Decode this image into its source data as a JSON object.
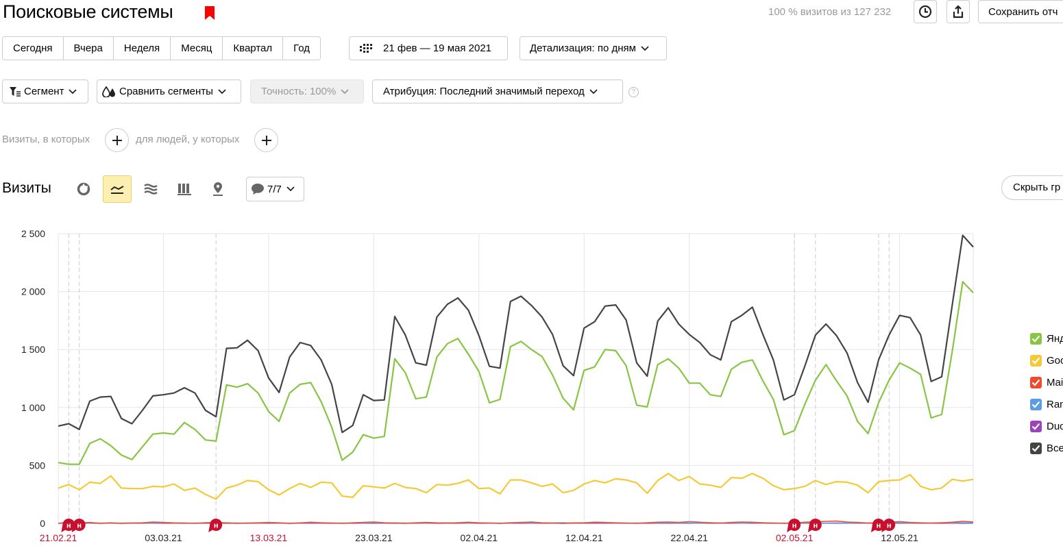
{
  "header": {
    "title": "Поисковые системы",
    "percent_text": "100 % визитов из 127 232",
    "save_label": "Сохранить отч"
  },
  "periods": [
    "Сегодня",
    "Вчера",
    "Неделя",
    "Месяц",
    "Квартал",
    "Год"
  ],
  "date_range": "21 фев — 19 мая 2021",
  "detail": "Детализация: по дням",
  "filters": {
    "segment": "Сегмент",
    "compare": "Сравнить сегменты",
    "accuracy": "Точность: 100%",
    "attribution": "Атрибуция: Последний значимый переход",
    "help": "?"
  },
  "conditions": {
    "visits": "Визиты, в которых",
    "people": "для людей, у которых"
  },
  "section": {
    "title": "Визиты",
    "notes": "7/7",
    "hide_label": "Скрыть гр"
  },
  "colors": {
    "yandex": "#87c542",
    "google": "#f5c935",
    "mail": "#f04a2e",
    "rambler": "#5a9de6",
    "duck": "#9c43bb",
    "total": "#444444",
    "holiday": "#c8102e"
  },
  "chart_data": {
    "type": "line",
    "y_ticks": [
      "2 500",
      "2 000",
      "1 500",
      "1 000",
      "500",
      "0"
    ],
    "ylim": [
      0,
      2500
    ],
    "x_ticks": [
      {
        "label": "21.02.21",
        "day": 0,
        "holiday": true
      },
      {
        "label": "03.03.21",
        "day": 10,
        "holiday": false
      },
      {
        "label": "13.03.21",
        "day": 20,
        "holiday": true
      },
      {
        "label": "23.03.21",
        "day": 30,
        "holiday": false
      },
      {
        "label": "02.04.21",
        "day": 40,
        "holiday": false
      },
      {
        "label": "12.04.21",
        "day": 50,
        "holiday": false
      },
      {
        "label": "22.04.21",
        "day": 60,
        "holiday": false
      },
      {
        "label": "02.05.21",
        "day": 70,
        "holiday": true
      },
      {
        "label": "12.05.21",
        "day": 80,
        "holiday": false
      }
    ],
    "annotations": [
      {
        "label": "н",
        "day": 1
      },
      {
        "label": "н",
        "day": 2
      },
      {
        "label": "н",
        "day": 15
      },
      {
        "label": "н",
        "day": 70
      },
      {
        "label": "н",
        "day": 72
      },
      {
        "label": "н",
        "day": 78
      },
      {
        "label": "н",
        "day": 79
      }
    ],
    "series": [
      {
        "name": "Янд",
        "key": "yandex",
        "values": [
          525,
          510,
          510,
          690,
          730,
          670,
          590,
          550,
          660,
          770,
          780,
          770,
          870,
          810,
          720,
          710,
          1195,
          1175,
          1205,
          1125,
          965,
          880,
          1125,
          1200,
          1215,
          1050,
          830,
          545,
          615,
          765,
          735,
          750,
          1420,
          1300,
          1075,
          1090,
          1435,
          1550,
          1595,
          1460,
          1310,
          1040,
          1070,
          1525,
          1570,
          1500,
          1440,
          1280,
          1080,
          980,
          1320,
          1350,
          1500,
          1490,
          1360,
          1020,
          1005,
          1370,
          1420,
          1340,
          1210,
          1210,
          1110,
          1095,
          1330,
          1390,
          1410,
          1230,
          1070,
          765,
          800,
          1030,
          1235,
          1370,
          1230,
          1100,
          880,
          775,
          1040,
          1235,
          1385,
          1340,
          1285,
          910,
          940,
          1480,
          2085,
          1990
        ]
      },
      {
        "name": "Goo",
        "key": "google",
        "values": [
          305,
          335,
          290,
          355,
          345,
          410,
          305,
          300,
          300,
          320,
          315,
          340,
          285,
          305,
          250,
          210,
          305,
          330,
          370,
          360,
          290,
          245,
          300,
          345,
          310,
          355,
          350,
          235,
          225,
          325,
          315,
          305,
          345,
          310,
          300,
          265,
          335,
          330,
          345,
          375,
          300,
          305,
          255,
          375,
          375,
          350,
          320,
          340,
          265,
          285,
          340,
          370,
          350,
          385,
          375,
          350,
          260,
          370,
          430,
          370,
          405,
          340,
          330,
          310,
          395,
          390,
          430,
          390,
          325,
          290,
          300,
          320,
          370,
          335,
          360,
          355,
          330,
          265,
          360,
          370,
          375,
          420,
          320,
          290,
          305,
          380,
          365,
          380
        ]
      },
      {
        "name": "Mai",
        "key": "mail",
        "values": [
          0,
          10,
          5,
          8,
          0,
          5,
          0,
          3,
          5,
          12,
          8,
          4,
          3,
          0,
          6,
          10,
          4,
          0,
          3,
          5,
          8,
          5,
          0,
          4,
          10,
          6,
          3,
          0,
          5,
          8,
          12,
          6,
          3,
          0,
          5,
          8,
          4,
          2,
          6,
          10,
          5,
          3,
          0,
          6,
          8,
          12,
          5,
          3,
          0,
          4,
          6,
          10,
          8,
          5,
          3,
          0,
          6,
          10,
          12,
          8,
          15,
          10,
          6,
          3,
          8,
          12,
          10,
          6,
          3,
          0,
          5,
          10,
          15,
          18,
          20,
          12,
          8,
          3,
          6,
          10,
          15,
          8,
          5,
          3,
          6,
          10,
          18,
          12
        ]
      },
      {
        "name": "Ram",
        "key": "rambler",
        "values": [
          2,
          3,
          2,
          4,
          3,
          2,
          3,
          4,
          2,
          3,
          5,
          4,
          3,
          2,
          3,
          4,
          5,
          3,
          2,
          3,
          4,
          3,
          2,
          3,
          4,
          5,
          3,
          2,
          3,
          4,
          5,
          3,
          4,
          3,
          2,
          3,
          4,
          5,
          3,
          2,
          4,
          3,
          2,
          3,
          4,
          5,
          3,
          4,
          6,
          3,
          2,
          8,
          4,
          3,
          2,
          3,
          4,
          5,
          3,
          4,
          3,
          2,
          3,
          4,
          3,
          2,
          3,
          4,
          3,
          2,
          3,
          4,
          5,
          3,
          4,
          3,
          2,
          3,
          4,
          5,
          4,
          3,
          2,
          3,
          4,
          5,
          6,
          4
        ]
      },
      {
        "name": "Duc",
        "key": "duck",
        "values": [
          1,
          2,
          1,
          2,
          1,
          2,
          1,
          2,
          1,
          2,
          1,
          2,
          1,
          2,
          1,
          2,
          1,
          2,
          1,
          2,
          1,
          2,
          1,
          2,
          1,
          2,
          1,
          2,
          1,
          2,
          1,
          2,
          1,
          2,
          1,
          2,
          1,
          2,
          1,
          2,
          1,
          2,
          1,
          2,
          1,
          2,
          1,
          2,
          1,
          2,
          1,
          2,
          1,
          2,
          1,
          2,
          1,
          2,
          1,
          2,
          1,
          2,
          1,
          2,
          1,
          2,
          1,
          2,
          1,
          2,
          1,
          2,
          1,
          2,
          1,
          2,
          1,
          2,
          1,
          2,
          1,
          2,
          1,
          2,
          1,
          2,
          1,
          2
        ]
      },
      {
        "name": "Все",
        "key": "total",
        "values": [
          840,
          860,
          810,
          1055,
          1090,
          1095,
          905,
          860,
          975,
          1100,
          1110,
          1125,
          1170,
          1125,
          975,
          920,
          1510,
          1515,
          1580,
          1490,
          1255,
          1130,
          1435,
          1560,
          1535,
          1410,
          1200,
          785,
          845,
          1110,
          1060,
          1065,
          1785,
          1625,
          1385,
          1365,
          1780,
          1890,
          1945,
          1840,
          1620,
          1355,
          1340,
          1915,
          1960,
          1880,
          1780,
          1630,
          1360,
          1275,
          1685,
          1740,
          1875,
          1885,
          1755,
          1385,
          1270,
          1745,
          1860,
          1720,
          1630,
          1560,
          1455,
          1410,
          1740,
          1795,
          1865,
          1630,
          1410,
          1065,
          1110,
          1360,
          1625,
          1720,
          1620,
          1470,
          1215,
          1045,
          1410,
          1625,
          1795,
          1775,
          1625,
          1225,
          1265,
          1880,
          2485,
          2385
        ]
      }
    ]
  }
}
